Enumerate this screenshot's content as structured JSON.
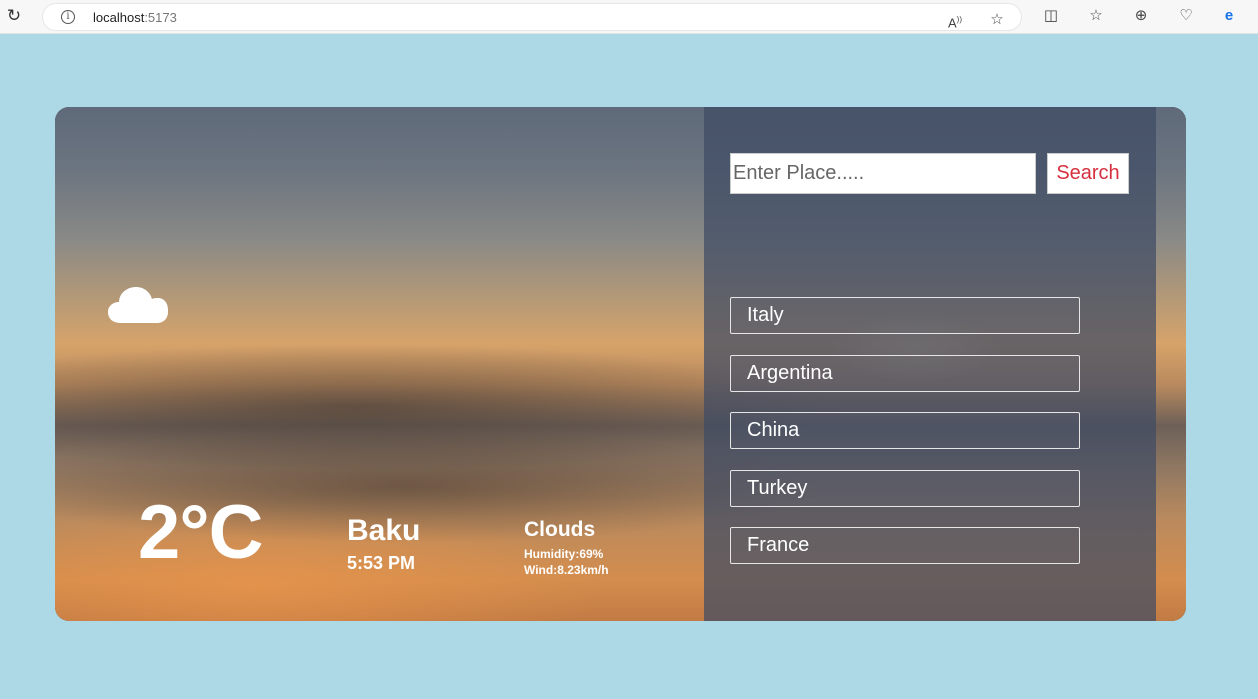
{
  "browser": {
    "url_host": "localhost",
    "url_port": ":5173",
    "reload_icon": "reload-icon",
    "info_icon": "info-icon"
  },
  "weather": {
    "temperature": "2°C",
    "city": "Baku",
    "time": "5:53 PM",
    "condition": "Clouds",
    "humidity": "Humidity:69%",
    "wind": "Wind:8.23km/h",
    "icon": "cloud-icon"
  },
  "search": {
    "placeholder": "Enter Place.....",
    "value": "",
    "button_label": "Search"
  },
  "places": [
    "Italy",
    "Argentina",
    "China",
    "Turkey",
    "France"
  ],
  "colors": {
    "page_background": "#add8e6",
    "search_button_text": "#d6303f",
    "text": "#ffffff"
  }
}
